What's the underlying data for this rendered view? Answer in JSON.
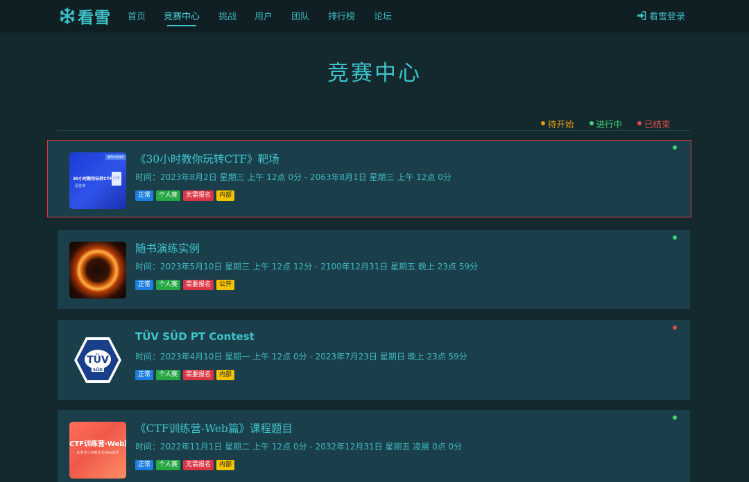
{
  "nav": {
    "logo_text": "看雪",
    "items": [
      "首页",
      "竞赛中心",
      "挑战",
      "用户",
      "团队",
      "排行榜",
      "论坛"
    ],
    "login": "看雪登录"
  },
  "page_title": "竞赛中心",
  "legend": [
    {
      "label": "待开始",
      "color": "#e69a14"
    },
    {
      "label": "进行中",
      "color": "#3fd47a"
    },
    {
      "label": "已结束",
      "color": "#e84a4a"
    }
  ],
  "colors": {
    "accent": "#3fc5cc",
    "running": "#3fd47a",
    "ended": "#e84a4a"
  },
  "cards": [
    {
      "title": "《30小时教你玩转CTF》靶场",
      "time": "时间：2023年8月2日 星期三 上午 12点 0分 - 2063年8月1日 星期三 上午 12点 0分",
      "tags": [
        "正常",
        "个人赛",
        "无需报名",
        "内部"
      ],
      "thumb": {
        "line1": "30小时教你玩转CTF",
        "line2": "看雪课",
        "badge": "看雪学院课程",
        "icon": "CTF"
      }
    },
    {
      "title": "随书演练实例",
      "time": "时间：2023年5月10日 星期三 上午 12点 12分 - 2100年12月31日 星期五 晚上 23点 59分",
      "tags": [
        "正常",
        "个人赛",
        "需要报名",
        "公开"
      ]
    },
    {
      "title": "TÜV SÜD PT Contest",
      "time": "时间：2023年4月10日 星期一 上午 12点 0分 - 2023年7月23日 星期日 晚上 23点 59分",
      "tags": [
        "正常",
        "个人赛",
        "需要报名",
        "内部"
      ],
      "thumb": {
        "line1": "TÜV",
        "line2": "SÜD"
      }
    },
    {
      "title": "《CTF训练营-Web篇》课程题目",
      "time": "时间：2022年11月1日 星期二 上午 12点 0分 - 2032年12月31日 星期五 凌晨 0点 0分",
      "tags": [
        "正常",
        "个人赛",
        "无需报名",
        "内部"
      ],
      "thumb": {
        "line1": "CTF训练营·Web篇",
        "line2": "从安全小白到主力Web选手"
      }
    }
  ]
}
